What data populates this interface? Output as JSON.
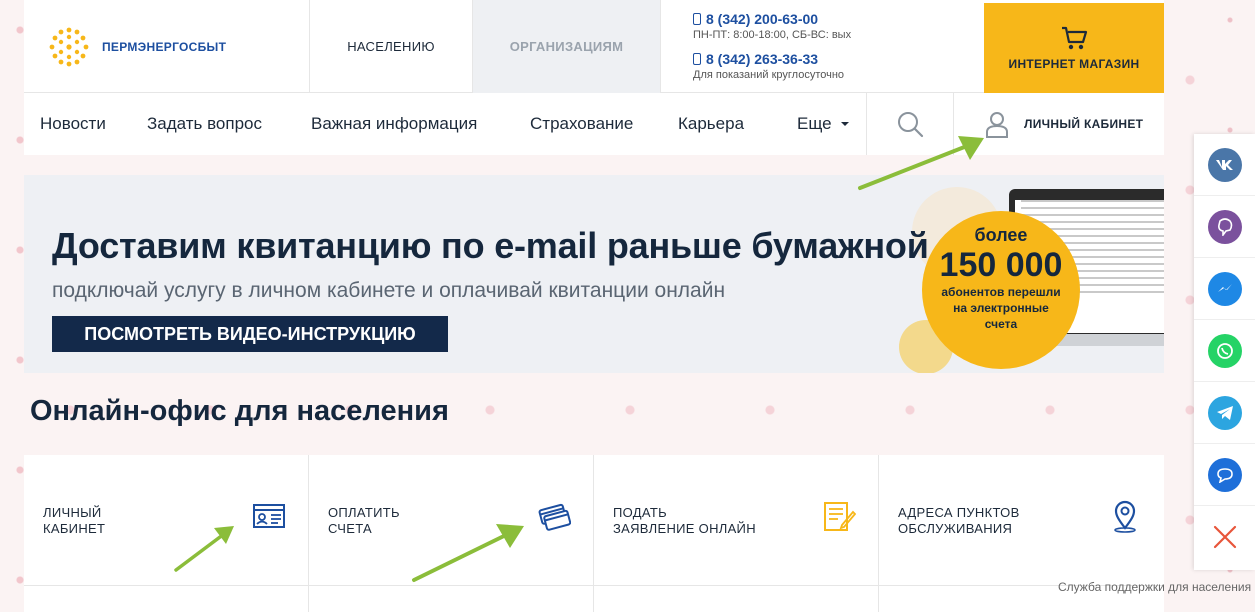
{
  "header": {
    "logo_text": "ПЕРМЭНЕРГОСБЫТ",
    "tab_population": "НАСЕЛЕНИЮ",
    "tab_organizations": "ОРГАНИЗАЦИЯМ",
    "phone1": "8 (342) 200-63-00",
    "phone1_hours": "ПН-ПТ: 8:00-18:00, СБ-ВС: вых",
    "phone2": "8 (342) 263-36-33",
    "phone2_note": "Для показаний круглосуточно",
    "shop_label": "ИНТЕРНЕТ МАГАЗИН"
  },
  "nav": {
    "items": [
      "Новости",
      "Задать вопрос",
      "Важная информация",
      "Страхование",
      "Карьера",
      "Еще"
    ],
    "cabinet_label": "ЛИЧНЫЙ КАБИНЕТ"
  },
  "banner": {
    "title": "Доставим квитанцию по e-mail раньше бумажной",
    "subtitle": "подключай услугу в личном кабинете и оплачивай квитанции онлайн",
    "button": "ПОСМОТРЕТЬ ВИДЕО-ИНСТРУКЦИЮ",
    "badge_top": "более",
    "badge_number": "150 000",
    "badge_text": "абонентов перешли на электронные счета"
  },
  "section": {
    "title": "Онлайн-офис для населения",
    "cards": [
      {
        "line1": "ЛИЧНЫЙ",
        "line2": "КАБИНЕТ",
        "icon": "id-card-icon"
      },
      {
        "line1": "ОПЛАТИТЬ",
        "line2": "СЧЕТА",
        "icon": "credit-cards-icon"
      },
      {
        "line1": "ПОДАТЬ",
        "line2": "ЗАЯВЛЕНИЕ ОНЛАЙН",
        "icon": "document-edit-icon"
      },
      {
        "line1": "АДРЕСА ПУНКТОВ",
        "line2": "ОБСЛУЖИВАНИЯ",
        "icon": "map-pin-icon"
      }
    ]
  },
  "social": {
    "items": [
      "vk-icon",
      "viber-icon",
      "messenger-icon",
      "whatsapp-icon",
      "telegram-icon",
      "chat-icon",
      "close-icon"
    ],
    "colors": {
      "vk": "#4a76a8",
      "viber": "#7b519d",
      "messenger": "#1e88e5",
      "whatsapp": "#25d366",
      "telegram": "#2ca5e0",
      "chat": "#1e6fd9",
      "close": "#e8553a"
    }
  },
  "support_text": "Служба поддержки для населения",
  "colors": {
    "accent": "#f7b719",
    "brand": "#1d4fa0",
    "dark": "#13294a",
    "arrow": "#8bbd3a"
  }
}
